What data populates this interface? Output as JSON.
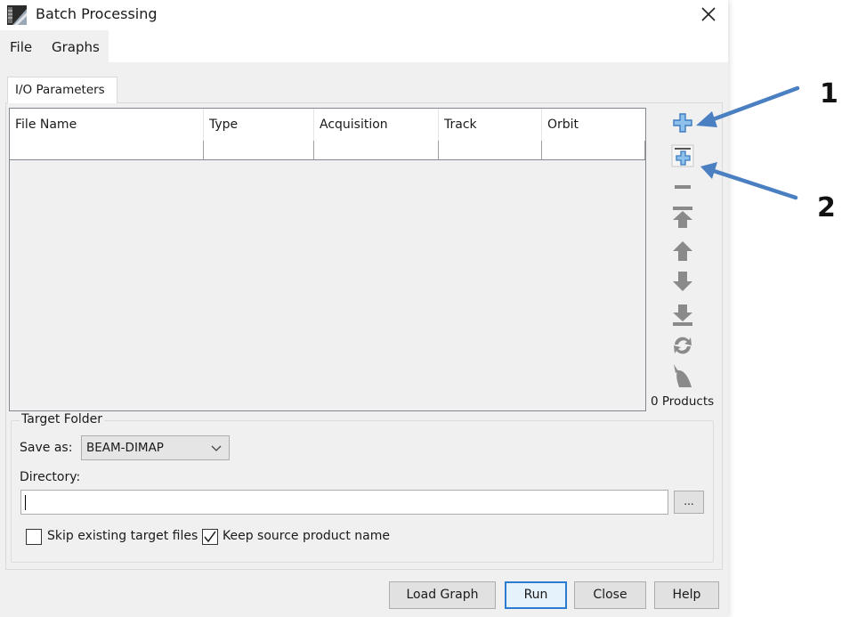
{
  "window": {
    "title": "Batch Processing",
    "close_label": "Close window"
  },
  "menubar": {
    "items": [
      {
        "label": "File"
      },
      {
        "label": "Graphs"
      }
    ]
  },
  "tabs": [
    {
      "label": "I/O Parameters",
      "active": true
    }
  ],
  "table": {
    "columns": [
      "File Name",
      "Type",
      "Acquisition",
      "Track",
      "Orbit"
    ],
    "rows": [
      [
        "",
        "",
        "",
        "",
        ""
      ]
    ]
  },
  "side_toolbar": {
    "buttons": [
      {
        "icon": "add-icon",
        "label": "Add",
        "enabled": true
      },
      {
        "icon": "add-opened-icon",
        "label": "Add Opened",
        "enabled": true
      },
      {
        "icon": "remove-icon",
        "label": "Remove",
        "enabled": false
      },
      {
        "icon": "move-top-icon",
        "label": "Move to top",
        "enabled": false
      },
      {
        "icon": "move-up-icon",
        "label": "Move up",
        "enabled": false
      },
      {
        "icon": "move-down-icon",
        "label": "Move down",
        "enabled": false
      },
      {
        "icon": "move-bottom-icon",
        "label": "Move to bottom",
        "enabled": false
      },
      {
        "icon": "refresh-icon",
        "label": "Refresh",
        "enabled": false
      },
      {
        "icon": "clear-icon",
        "label": "Clear",
        "enabled": false
      }
    ],
    "product_count": "0 Products"
  },
  "target_folder": {
    "legend": "Target Folder",
    "save_as_label": "Save as:",
    "save_as_value": "BEAM-DIMAP",
    "directory_label": "Directory:",
    "directory_value": "",
    "browse_label": "...",
    "skip_existing": {
      "label": "Skip existing target files",
      "checked": false
    },
    "keep_source_name": {
      "label": "Keep source product name",
      "checked": true
    }
  },
  "footer": {
    "buttons": [
      {
        "label": "Load Graph"
      },
      {
        "label": "Run",
        "default": true
      },
      {
        "label": "Close"
      },
      {
        "label": "Help"
      }
    ]
  },
  "annotations": [
    {
      "number": "1",
      "points_to": "add-icon"
    },
    {
      "number": "2",
      "points_to": "add-opened-icon"
    }
  ],
  "colors": {
    "icon_blue": "#4f8fd0",
    "icon_disabled": "#8a8a8a",
    "annotation_arrow": "#4a7fc1",
    "default_button_border": "#2b7bd1"
  }
}
